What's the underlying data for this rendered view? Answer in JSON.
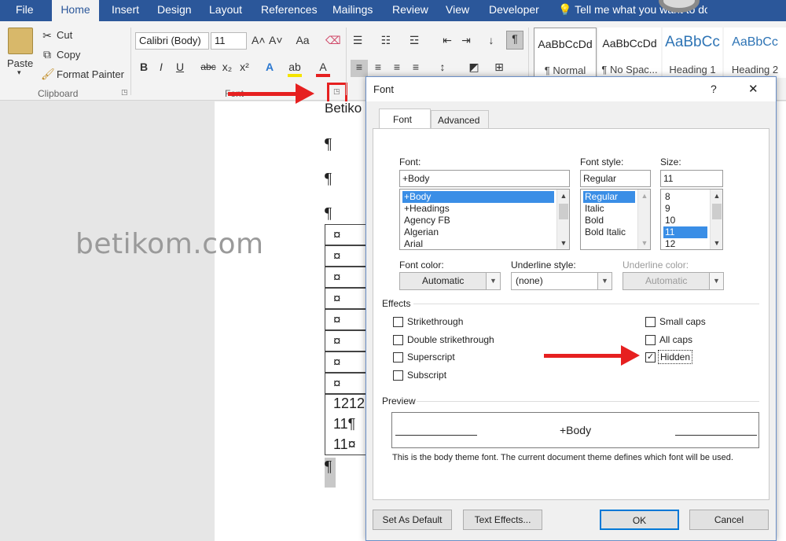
{
  "tabs": [
    "File",
    "Home",
    "Insert",
    "Design",
    "Layout",
    "References",
    "Mailings",
    "Review",
    "View",
    "Developer"
  ],
  "tell_me": "Tell me what you want to do",
  "clipboard": {
    "paste": "Paste",
    "cut": "Cut",
    "copy": "Copy",
    "format_painter": "Format Painter",
    "group": "Clipboard"
  },
  "font_group": {
    "font_name": "Calibri (Body)",
    "font_size": "11",
    "group": "Font",
    "bold": "B",
    "italic": "I",
    "underline": "U",
    "strike": "abc",
    "sub": "x₂",
    "sup": "x²",
    "case": "Aa"
  },
  "styles": [
    {
      "sample": "AaBbCcDd",
      "name": "¶ Normal"
    },
    {
      "sample": "AaBbCcDd",
      "name": "¶ No Spac..."
    },
    {
      "sample": "AaBbCc",
      "name": "Heading 1"
    },
    {
      "sample": "AaBbCc",
      "name": "Heading 2"
    }
  ],
  "document": {
    "first_line": "Betiko",
    "marks": [
      "¶",
      "¶",
      "¶"
    ],
    "table_cells": [
      "¤",
      "¤",
      "¤",
      "¤",
      "¤",
      "¤",
      "¤",
      "¤",
      "1212",
      "11¶",
      "11¤"
    ],
    "last_mark": "¶",
    "watermark": "betikom.com"
  },
  "dialog": {
    "title": "Font",
    "help": "?",
    "close": "✕",
    "tab_font": "Font",
    "tab_advanced": "Advanced",
    "font_label": "Font:",
    "font_value": "+Body",
    "font_list": [
      "+Body",
      "+Headings",
      "Agency FB",
      "Algerian",
      "Arial"
    ],
    "style_label": "Font style:",
    "style_value": "Regular",
    "style_list": [
      "Regular",
      "Italic",
      "Bold",
      "Bold Italic"
    ],
    "size_label": "Size:",
    "size_value": "11",
    "size_list": [
      "8",
      "9",
      "10",
      "11",
      "12"
    ],
    "font_color_label": "Font color:",
    "font_color_value": "Automatic",
    "underline_style_label": "Underline style:",
    "underline_style_value": "(none)",
    "underline_color_label": "Underline color:",
    "underline_color_value": "Automatic",
    "effects_label": "Effects",
    "effects_left": [
      {
        "label": "Strikethrough",
        "checked": false
      },
      {
        "label": "Double strikethrough",
        "checked": false
      },
      {
        "label": "Superscript",
        "checked": false
      },
      {
        "label": "Subscript",
        "checked": false
      }
    ],
    "effects_right": [
      {
        "label": "Small caps",
        "checked": false
      },
      {
        "label": "All caps",
        "checked": false
      },
      {
        "label": "Hidden",
        "checked": true
      }
    ],
    "preview_label": "Preview",
    "preview_text": "+Body",
    "preview_note": "This is the body theme font. The current document theme defines which font will be used.",
    "set_default": "Set As Default",
    "text_effects": "Text Effects...",
    "ok": "OK",
    "cancel": "Cancel"
  },
  "colors": {
    "ribbon_blue": "#2b579a",
    "highlight": "#e62020",
    "selection": "#3a8ee6"
  }
}
